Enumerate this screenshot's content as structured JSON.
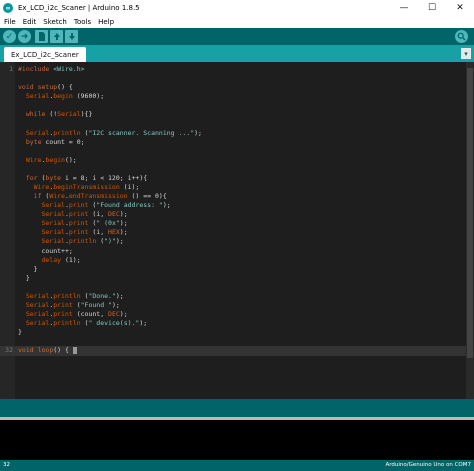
{
  "window": {
    "title": "Ex_LCD_i2c_Scaner | Arduino 1.8.5",
    "minimize": "—",
    "maximize": "☐",
    "close": "✕"
  },
  "menu": [
    "File",
    "Edit",
    "Sketch",
    "Tools",
    "Help"
  ],
  "toolbar": {
    "verify_icon": "check-icon",
    "upload_icon": "arrow-right-icon",
    "new_icon": "new-file-icon",
    "open_icon": "open-arrow-up-icon",
    "save_icon": "save-arrow-down-icon",
    "serial_monitor_icon": "magnifier-icon"
  },
  "tabs": [
    {
      "label": "Ex_LCD_i2c_Scaner"
    }
  ],
  "tab_menu_label": "▾",
  "code": [
    {
      "n": "1",
      "html": "<span class='kw'>#include</span> <span class='str'>&lt;Wire.h&gt;</span>"
    },
    {
      "n": "",
      "html": ""
    },
    {
      "n": "",
      "html": "<span class='kw'>void</span> <span class='kw'>setup</span>() {"
    },
    {
      "n": "",
      "html": "  <span class='fn'>Serial</span>.<span class='fn'>begin</span> (9600);"
    },
    {
      "n": "",
      "html": ""
    },
    {
      "n": "",
      "html": "  <span class='kw'>while</span> (!<span class='fn'>Serial</span>){}"
    },
    {
      "n": "",
      "html": ""
    },
    {
      "n": "",
      "html": "  <span class='fn'>Serial</span>.<span class='fn'>println</span> (<span class='str'>\"I2C scanner. Scanning ...\"</span>);"
    },
    {
      "n": "",
      "html": "  <span class='kw'>byte</span> count = 0;"
    },
    {
      "n": "",
      "html": ""
    },
    {
      "n": "",
      "html": "  <span class='fn'>Wire</span>.<span class='fn'>begin</span>();"
    },
    {
      "n": "",
      "html": ""
    },
    {
      "n": "",
      "html": "  <span class='kw'>for</span> (<span class='kw'>byte</span> i = 8; i &lt; 120; i++){"
    },
    {
      "n": "",
      "html": "    <span class='fn'>Wire</span>.<span class='fn'>beginTransmission</span> (i);"
    },
    {
      "n": "",
      "html": "    <span class='kw'>if</span> (<span class='fn'>Wire</span>.<span class='fn'>endTransmission</span> () == 0){"
    },
    {
      "n": "",
      "html": "      <span class='fn'>Serial</span>.<span class='fn'>print</span> (<span class='str'>\"Found address: \"</span>);"
    },
    {
      "n": "",
      "html": "      <span class='fn'>Serial</span>.<span class='fn'>print</span> (i, <span class='kw'>DEC</span>);"
    },
    {
      "n": "",
      "html": "      <span class='fn'>Serial</span>.<span class='fn'>print</span> (<span class='str'>\" (0x\"</span>);"
    },
    {
      "n": "",
      "html": "      <span class='fn'>Serial</span>.<span class='fn'>print</span> (i, <span class='kw'>HEX</span>);"
    },
    {
      "n": "",
      "html": "      <span class='fn'>Serial</span>.<span class='fn'>println</span> (<span class='str'>\")\"</span>);"
    },
    {
      "n": "",
      "html": "      count++;"
    },
    {
      "n": "",
      "html": "      <span class='fn'>delay</span> (1);"
    },
    {
      "n": "",
      "html": "    }"
    },
    {
      "n": "",
      "html": "  }"
    },
    {
      "n": "",
      "html": ""
    },
    {
      "n": "",
      "html": "  <span class='fn'>Serial</span>.<span class='fn'>println</span> (<span class='str'>\"Done.\"</span>);"
    },
    {
      "n": "",
      "html": "  <span class='fn'>Serial</span>.<span class='fn'>print</span> (<span class='str'>\"Found \"</span>);"
    },
    {
      "n": "",
      "html": "  <span class='fn'>Serial</span>.<span class='fn'>print</span> (count, <span class='kw'>DEC</span>);"
    },
    {
      "n": "",
      "html": "  <span class='fn'>Serial</span>.<span class='fn'>println</span> (<span class='str'>\" device(s).\"</span>);"
    },
    {
      "n": "",
      "html": "}"
    },
    {
      "n": "",
      "html": ""
    },
    {
      "n": "32",
      "html": "<span class='kw'>void</span> <span class='kw'>loop</span>() { <span class='cursor'></span>",
      "current": true
    }
  ],
  "status": {
    "line_number": "32",
    "board": "Arduino/Genuino Uno on COM7"
  }
}
